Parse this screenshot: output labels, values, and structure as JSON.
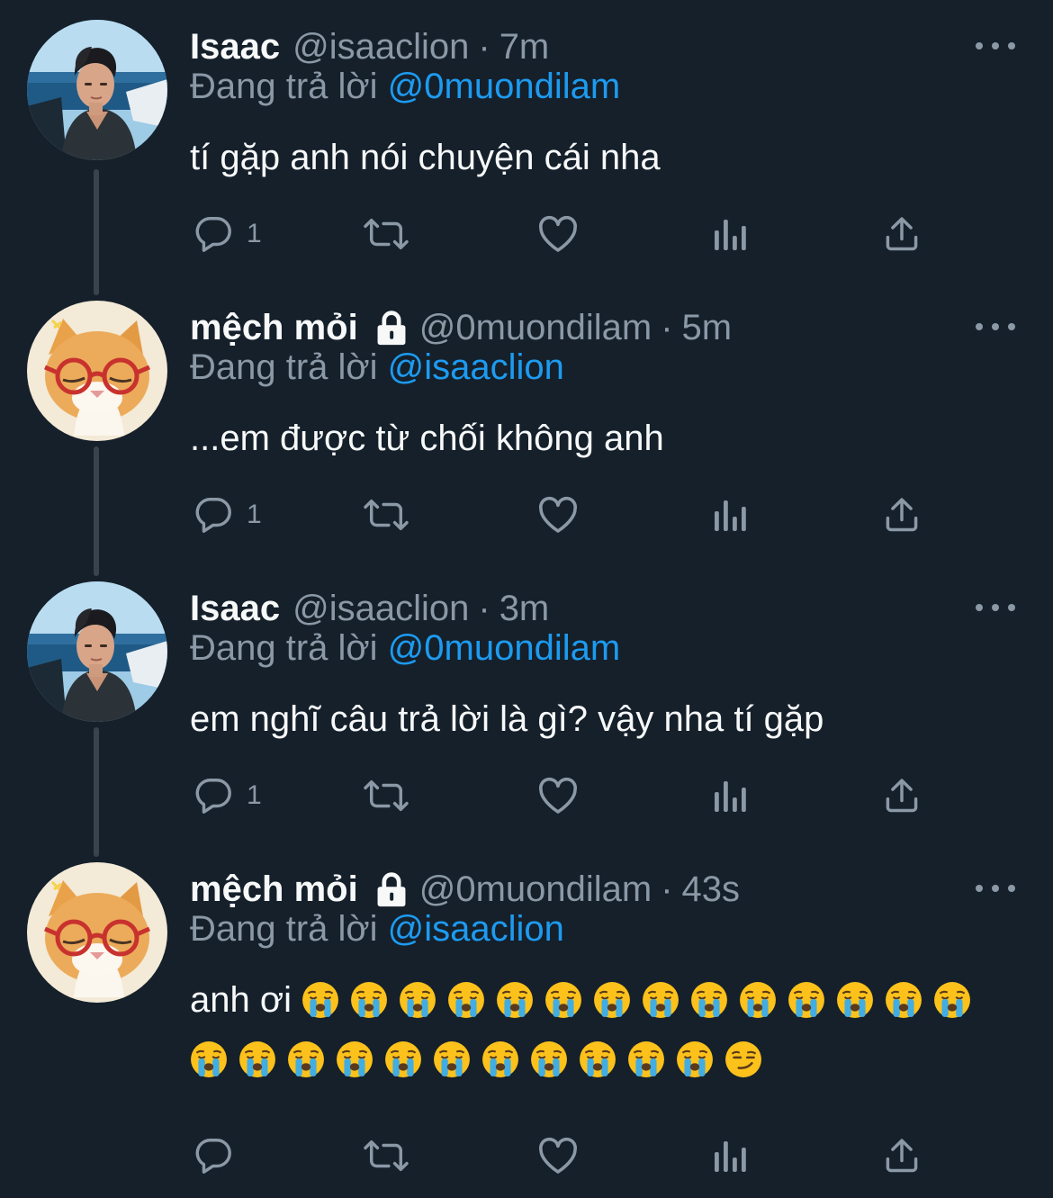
{
  "tweets": [
    {
      "name": "Isaac",
      "handle": "@isaaclion",
      "separator": "·",
      "time": "7m",
      "locked": false,
      "replying_prefix": "Đang trả lời",
      "replying_to": "@0muondilam",
      "text": "tí gặp anh nói chuyện cái nha",
      "reply_count": "1",
      "avatar": "man-portrait"
    },
    {
      "name": "mệch mỏi",
      "handle": "@0muondilam",
      "separator": "·",
      "time": "5m",
      "locked": true,
      "replying_prefix": "Đang trả lời",
      "replying_to": "@isaaclion",
      "text": "...em được từ chối không anh",
      "reply_count": "1",
      "avatar": "cat-with-glasses"
    },
    {
      "name": "Isaac",
      "handle": "@isaaclion",
      "separator": "·",
      "time": "3m",
      "locked": false,
      "replying_prefix": "Đang trả lời",
      "replying_to": "@0muondilam",
      "text": "em nghĩ câu trả lời là gì? vậy nha tí gặp",
      "reply_count": "1",
      "avatar": "man-portrait"
    },
    {
      "name": "mệch mỏi",
      "handle": "@0muondilam",
      "separator": "·",
      "time": "43s",
      "locked": true,
      "replying_prefix": "Đang trả lời",
      "replying_to": "@isaaclion",
      "text": "anh ơi",
      "emoji_line1": [
        "😭",
        "😭",
        "😭",
        "😭",
        "😭",
        "😭",
        "😭",
        "😭",
        "😭",
        "😭",
        "😭",
        "😭",
        "😭",
        "😭"
      ],
      "emoji_line2": [
        "😭",
        "😭",
        "😭",
        "😭",
        "😭",
        "😭",
        "😭",
        "😭",
        "😭",
        "😭",
        "😭",
        "😏"
      ],
      "reply_count": "",
      "avatar": "cat-with-glasses"
    }
  ],
  "colors": {
    "background": "#15202b",
    "text": "#f7f9f9",
    "secondary": "#8b98a5",
    "link": "#1d9bf0",
    "thread_line": "#38444d"
  }
}
